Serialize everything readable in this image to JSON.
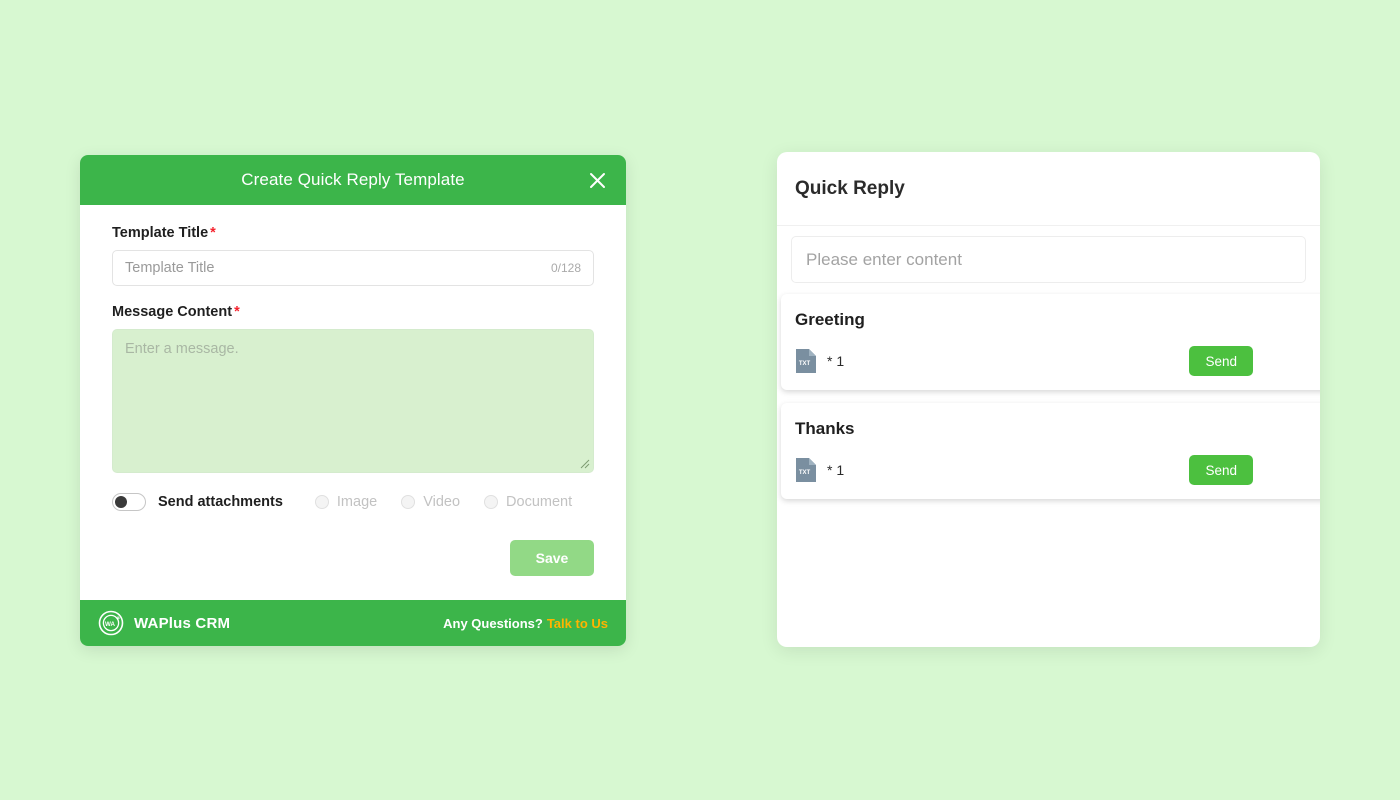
{
  "theme": {
    "page_background": "#d7f8d1",
    "brand_green": "#3cb54a",
    "send_green": "#4cc03f",
    "save_disabled_green": "#92d986",
    "link_orange": "#ffb400",
    "required_red": "#f5222d",
    "textarea_green": "#d8f0cf"
  },
  "dialog": {
    "title": "Create Quick Reply Template",
    "close_icon": "close-icon",
    "template_title": {
      "label": "Template Title",
      "required_marker": "*",
      "placeholder": "Template Title",
      "value": "",
      "counter": "0/128"
    },
    "message_content": {
      "label": "Message Content",
      "required_marker": "*",
      "placeholder": "Enter a message.",
      "value": ""
    },
    "attachments": {
      "toggle_state": "off",
      "label": "Send attachments",
      "options": [
        {
          "label": "Image",
          "selected": false,
          "disabled": true
        },
        {
          "label": "Video",
          "selected": false,
          "disabled": true
        },
        {
          "label": "Document",
          "selected": false,
          "disabled": true
        }
      ]
    },
    "actions": {
      "save_label": "Save",
      "save_disabled": true
    },
    "footer": {
      "logo_icon": "waplus-logo-icon",
      "brand": "WAPlus CRM",
      "question": "Any Questions?",
      "link": "Talk to Us"
    }
  },
  "quick_reply_panel": {
    "title": "Quick Reply",
    "search": {
      "placeholder": "Please enter content",
      "value": ""
    },
    "items": [
      {
        "title": "Greeting",
        "file_icon": "txt-file-icon",
        "file_label": "TXT",
        "count": "* 1",
        "send_label": "Send"
      },
      {
        "title": "Thanks",
        "file_icon": "txt-file-icon",
        "file_label": "TXT",
        "count": "* 1",
        "send_label": "Send"
      }
    ]
  }
}
